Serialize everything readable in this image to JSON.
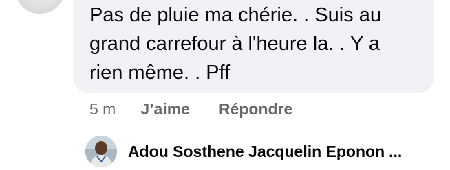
{
  "comment": {
    "lines": [
      "Pas de pluie ma chérie. . Suis au",
      "grand carrefour à l'heure la. . Y a",
      "rien même. . Pff"
    ]
  },
  "actions": {
    "time": "5 m",
    "like_label": "J’aime",
    "reply_label": "Répondre"
  },
  "reply_preview": {
    "author": "Adou Sosthene Jacquelin Eponon",
    "more": "...",
    "avatar_icon": "user-photo-icon"
  },
  "colors": {
    "bubble": "#f0f2f5",
    "text": "#050505",
    "muted": "#65676b"
  }
}
